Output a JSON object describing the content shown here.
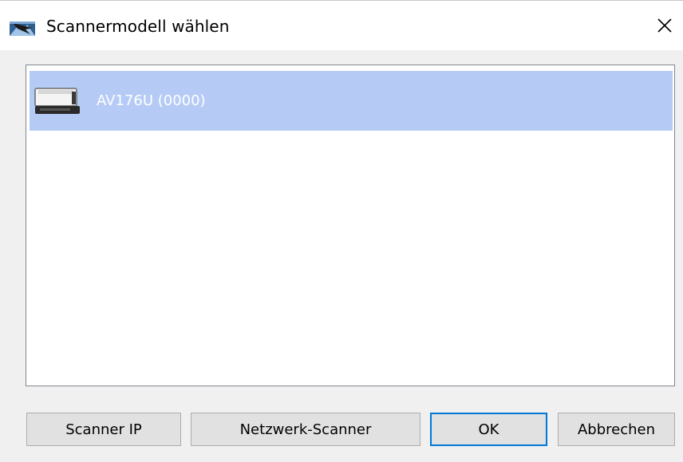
{
  "window": {
    "title": "Scannermodell wählen",
    "icon": "scanner-app-icon",
    "close_icon": "close-icon"
  },
  "scanner_list": {
    "items": [
      {
        "label": "AV176U (0000)",
        "icon": "scanner-device-icon",
        "selected": true
      }
    ]
  },
  "buttons": {
    "scanner_ip": "Scanner IP",
    "network_scanner": "Netzwerk-Scanner",
    "ok": "OK",
    "cancel": "Abbrechen"
  },
  "colors": {
    "selection": "#b5cbf6",
    "focus_border": "#0078d7",
    "button_face": "#e1e1e1"
  }
}
